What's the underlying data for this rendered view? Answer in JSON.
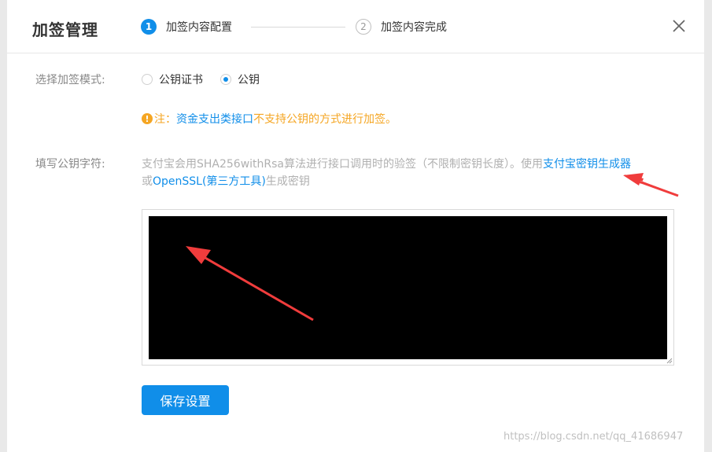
{
  "dialog": {
    "title": "加签管理",
    "close_icon": "close-icon"
  },
  "steps": [
    {
      "number": "1",
      "label": "加签内容配置",
      "state": "active"
    },
    {
      "number": "2",
      "label": "加签内容完成",
      "state": "pending"
    }
  ],
  "mode": {
    "label": "选择加签模式:",
    "options": [
      {
        "label": "公钥证书",
        "checked": false
      },
      {
        "label": "公钥",
        "checked": true
      }
    ]
  },
  "note": {
    "icon": "warning-icon",
    "icon_glyph": "!",
    "prefix": "注：",
    "highlight": "资金支出类接口",
    "suffix": "不支持公钥的方式进行加签。"
  },
  "key_field": {
    "label": "填写公钥字符:",
    "desc_part1": "支付宝会用SHA256withRsa算法进行接口调用时的验签（不限制密钥长度）。使用",
    "link1": "支付宝密钥生成器",
    "desc_part2": "或",
    "link2": "OpenSSL(第三方工具)",
    "desc_part3": "生成密钥",
    "value": ""
  },
  "save_button": {
    "label": "保存设置"
  },
  "watermark": "https://blog.csdn.net/qq_41686947",
  "colors": {
    "accent": "#108ee9",
    "warning": "#f5a623",
    "annotation_arrow": "#f03c3c"
  }
}
